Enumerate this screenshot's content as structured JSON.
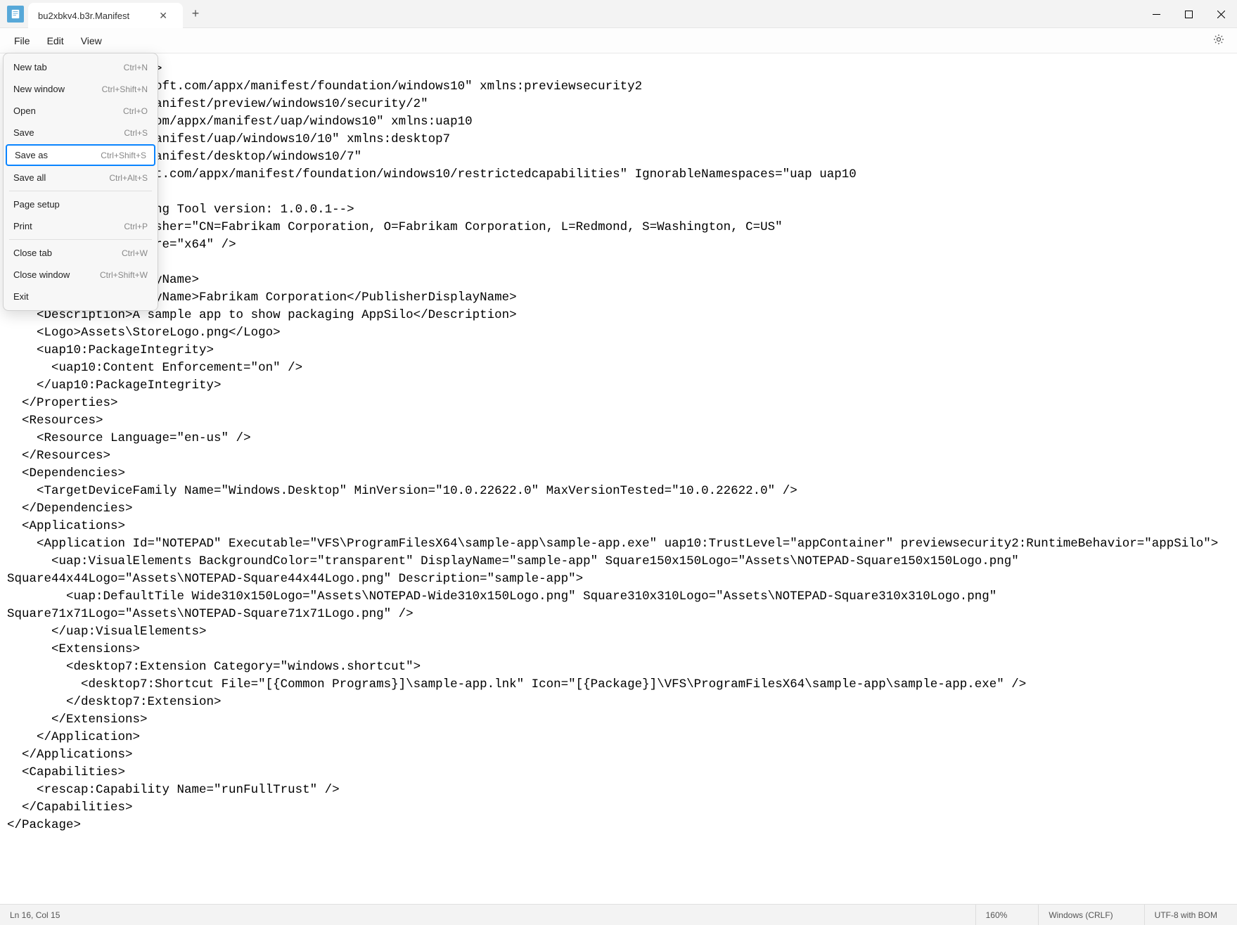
{
  "titlebar": {
    "tab_title": "bu2xbkv4.b3r.Manifest",
    "close_glyph": "✕",
    "new_tab_glyph": "+",
    "minimize_glyph": "—",
    "maximize_glyph": "▢",
    "winclose_glyph": "✕"
  },
  "menubar": {
    "file": "File",
    "edit": "Edit",
    "view": "View",
    "settings_glyph": "⚙"
  },
  "file_menu": {
    "new_tab": "New tab",
    "new_tab_sc": "Ctrl+N",
    "new_window": "New window",
    "new_window_sc": "Ctrl+Shift+N",
    "open": "Open",
    "open_sc": "Ctrl+O",
    "save": "Save",
    "save_sc": "Ctrl+S",
    "save_as": "Save as",
    "save_as_sc": "Ctrl+Shift+S",
    "save_all": "Save all",
    "save_all_sc": "Ctrl+Alt+S",
    "page_setup": "Page setup",
    "print": "Print",
    "print_sc": "Ctrl+P",
    "close_tab": "Close tab",
    "close_tab_sc": "Ctrl+W",
    "close_window": "Close window",
    "close_window_sc": "Ctrl+Shift+W",
    "exit": "Exit"
  },
  "editor": {
    "content": "0\" encoding=\"utf-8\"?>\nttp://schemas.microsoft.com/appx/manifest/foundation/windows10\" xmlns:previewsecurity2\nmicrosoft.com/appx/manifest/preview/windows10/security/2\"\n/schemas.microsoft.com/appx/manifest/uap/windows10\" xmlns:uap10\nmicrosoft.com/appx/manifest/uap/windows10/10\" xmlns:desktop7\nmicrosoft.com/appx/manifest/desktop/windows10/7\"\np://schemas.microsoft.com/appx/manifest/foundation/windows10/restrictedcapabilities\" IgnorableNamespaces=\"uap uap10\nreviewsecurity2\">\nated by MSIX Packaging Tool version: 1.0.0.1-->\n\"Test-AppSilo\" Publisher=\"CN=Fabrikam Corporation, O=Fabrikam Corporation, L=Redmond, S=Washington, C=US\"\n ProcessorArchitecture=\"x64\" />\n\nTest AppSilo</DisplayName>\n    <PublisherDisplayName>Fabrikam Corporation</PublisherDisplayName>\n    <Description>A sample app to show packaging AppSilo</Description>\n    <Logo>Assets\\StoreLogo.png</Logo>\n    <uap10:PackageIntegrity>\n      <uap10:Content Enforcement=\"on\" />\n    </uap10:PackageIntegrity>\n  </Properties>\n  <Resources>\n    <Resource Language=\"en-us\" />\n  </Resources>\n  <Dependencies>\n    <TargetDeviceFamily Name=\"Windows.Desktop\" MinVersion=\"10.0.22622.0\" MaxVersionTested=\"10.0.22622.0\" />\n  </Dependencies>\n  <Applications>\n    <Application Id=\"NOTEPAD\" Executable=\"VFS\\ProgramFilesX64\\sample-app\\sample-app.exe\" uap10:TrustLevel=\"appContainer\" previewsecurity2:RuntimeBehavior=\"appSilo\">\n      <uap:VisualElements BackgroundColor=\"transparent\" DisplayName=\"sample-app\" Square150x150Logo=\"Assets\\NOTEPAD-Square150x150Logo.png\" Square44x44Logo=\"Assets\\NOTEPAD-Square44x44Logo.png\" Description=\"sample-app\">\n        <uap:DefaultTile Wide310x150Logo=\"Assets\\NOTEPAD-Wide310x150Logo.png\" Square310x310Logo=\"Assets\\NOTEPAD-Square310x310Logo.png\" Square71x71Logo=\"Assets\\NOTEPAD-Square71x71Logo.png\" />\n      </uap:VisualElements>\n      <Extensions>\n        <desktop7:Extension Category=\"windows.shortcut\">\n          <desktop7:Shortcut File=\"[{Common Programs}]\\sample-app.lnk\" Icon=\"[{Package}]\\VFS\\ProgramFilesX64\\sample-app\\sample-app.exe\" />\n        </desktop7:Extension>\n      </Extensions>\n    </Application>\n  </Applications>\n  <Capabilities>\n    <rescap:Capability Name=\"runFullTrust\" />\n  </Capabilities>\n</Package>"
  },
  "statusbar": {
    "position": "Ln 16, Col 15",
    "zoom": "160%",
    "line_ending": "Windows (CRLF)",
    "encoding": "UTF-8 with BOM"
  }
}
